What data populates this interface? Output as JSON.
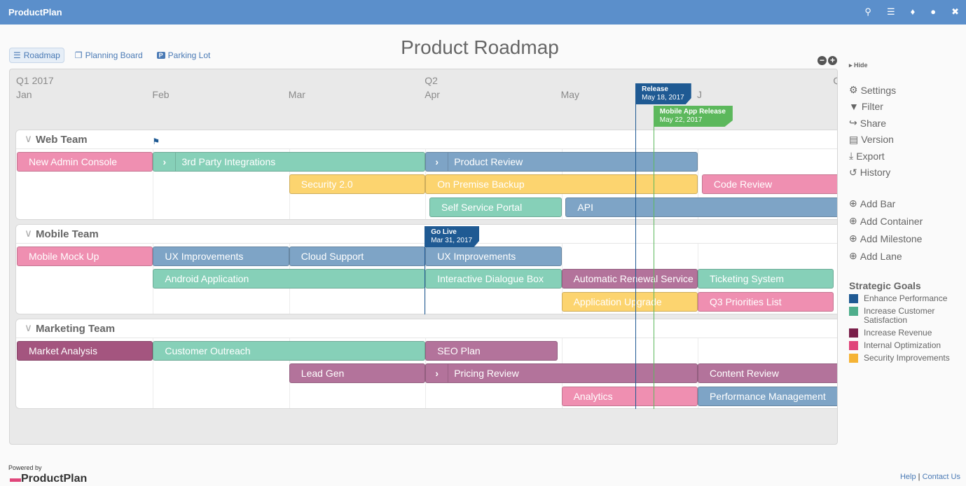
{
  "app": {
    "brand": "ProductPlan",
    "title": "Product Roadmap",
    "top_icons": [
      "search-icon",
      "roadmap-icon",
      "bell-icon",
      "user-icon",
      "fullscreen-icon"
    ]
  },
  "views": [
    {
      "label": "Roadmap",
      "active": true
    },
    {
      "label": "Planning Board"
    },
    {
      "label": "Parking Lot"
    }
  ],
  "timeline": {
    "quarters": [
      {
        "label": "Q1 2017",
        "month": 1
      },
      {
        "label": "Q2",
        "month": 4
      },
      {
        "label": "Q",
        "month": 7
      }
    ],
    "months": [
      "Jan",
      "Feb",
      "Mar",
      "Apr",
      "May",
      "J"
    ]
  },
  "colors": {
    "pink": "#ef8fb1",
    "teal": "#86d0b8",
    "blue": "#7ea4c6",
    "yellow": "#fcd46f",
    "purple": "#b3739b",
    "mauve": "#a4557f"
  },
  "containers": [
    {
      "name": "Web Team",
      "bars": [
        {
          "label": "New Admin Console",
          "start": 1,
          "end": 2,
          "row": 0,
          "color": "pink"
        },
        {
          "label": "3rd Party Integrations",
          "start": 2,
          "end": 4,
          "row": 0,
          "color": "teal",
          "expand": true
        },
        {
          "label": "Product Review",
          "start": 4,
          "end": 6,
          "row": 0,
          "color": "blue",
          "expand": true
        },
        {
          "label": "Security 2.0",
          "start": 3,
          "end": 4,
          "row": 1,
          "color": "yellow"
        },
        {
          "label": "On Premise Backup",
          "start": 4,
          "end": 6,
          "row": 1,
          "color": "yellow"
        },
        {
          "label": "Code Review",
          "start": 6.03,
          "end": 7.1,
          "row": 1,
          "color": "pink"
        },
        {
          "label": "Self Service Portal",
          "start": 4.03,
          "end": 5,
          "row": 2,
          "color": "teal"
        },
        {
          "label": "API",
          "start": 5.03,
          "end": 7.1,
          "row": 2,
          "color": "blue"
        }
      ]
    },
    {
      "name": "Mobile Team",
      "bars": [
        {
          "label": "Mobile Mock Up",
          "start": 1,
          "end": 2,
          "row": 0,
          "color": "pink"
        },
        {
          "label": "UX Improvements",
          "start": 2,
          "end": 3,
          "row": 0,
          "color": "blue"
        },
        {
          "label": "Cloud Support",
          "start": 3,
          "end": 4,
          "row": 0,
          "color": "blue"
        },
        {
          "label": "UX Improvements",
          "start": 4,
          "end": 5,
          "row": 0,
          "color": "blue"
        },
        {
          "label": "Android Application",
          "start": 2,
          "end": 4,
          "row": 1,
          "color": "teal"
        },
        {
          "label": "Interactive Dialogue Box",
          "start": 4,
          "end": 5,
          "row": 1,
          "color": "teal"
        },
        {
          "label": "Automatic Renewal Service",
          "start": 5,
          "end": 6,
          "row": 1,
          "color": "purple"
        },
        {
          "label": "Ticketing System",
          "start": 6,
          "end": 7,
          "row": 1,
          "color": "teal"
        },
        {
          "label": "Application Upgrade",
          "start": 5,
          "end": 6,
          "row": 2,
          "color": "yellow"
        },
        {
          "label": "Q3 Priorities List",
          "start": 6,
          "end": 7,
          "row": 2,
          "color": "pink"
        }
      ]
    },
    {
      "name": "Marketing Team",
      "bars": [
        {
          "label": "Market Analysis",
          "start": 1,
          "end": 2,
          "row": 0,
          "color": "mauve"
        },
        {
          "label": "Customer Outreach",
          "start": 2,
          "end": 4,
          "row": 0,
          "color": "teal"
        },
        {
          "label": "SEO Plan",
          "start": 4,
          "end": 4.97,
          "row": 0,
          "color": "purple"
        },
        {
          "label": "Lead Gen",
          "start": 3,
          "end": 4,
          "row": 1,
          "color": "purple"
        },
        {
          "label": "Pricing Review",
          "start": 4,
          "end": 6,
          "row": 1,
          "color": "purple",
          "expand": true
        },
        {
          "label": "Content Review",
          "start": 6,
          "end": 7.1,
          "row": 1,
          "color": "purple"
        },
        {
          "label": "Analytics",
          "start": 5,
          "end": 6,
          "row": 2,
          "color": "pink"
        },
        {
          "label": "Performance Management",
          "start": 6,
          "end": 7.1,
          "row": 2,
          "color": "blue"
        }
      ]
    }
  ],
  "milestones": [
    {
      "name": "Release",
      "date": "May 18, 2017",
      "month": 5.548,
      "color": "#1f5a93"
    },
    {
      "name": "Mobile App Release",
      "date": "May 22, 2017",
      "month": 5.68,
      "color": "#5cb85c"
    },
    {
      "name": "Go Live",
      "date": "Mar 31, 2017",
      "month": 4.0,
      "color": "#1f5a93",
      "container": 1
    }
  ],
  "sidebar": {
    "hide": "Hide",
    "actions": [
      {
        "label": "Settings",
        "icon": "gear-icon"
      },
      {
        "label": "Filter",
        "icon": "filter-icon"
      },
      {
        "label": "Share",
        "icon": "share-icon"
      },
      {
        "label": "Version",
        "icon": "archive-icon"
      },
      {
        "label": "Export",
        "icon": "download-icon"
      },
      {
        "label": "History",
        "icon": "history-icon"
      }
    ],
    "add": [
      "Add Bar",
      "Add Container",
      "Add Milestone",
      "Add Lane"
    ]
  },
  "goals": {
    "title": "Strategic Goals",
    "items": [
      {
        "label": "Enhance Performance",
        "color": "#1f5a93"
      },
      {
        "label": "Increase Customer Satisfaction",
        "color": "#4fae8c"
      },
      {
        "label": "Increase Revenue",
        "color": "#7a1f4a"
      },
      {
        "label": "Internal Optimization",
        "color": "#e0457a"
      },
      {
        "label": "Security Improvements",
        "color": "#f5b335"
      }
    ]
  },
  "footer": {
    "powered": "Powered by",
    "logo": "ProductPlan",
    "help": "Help",
    "sep": "|",
    "contact": "Contact Us"
  }
}
